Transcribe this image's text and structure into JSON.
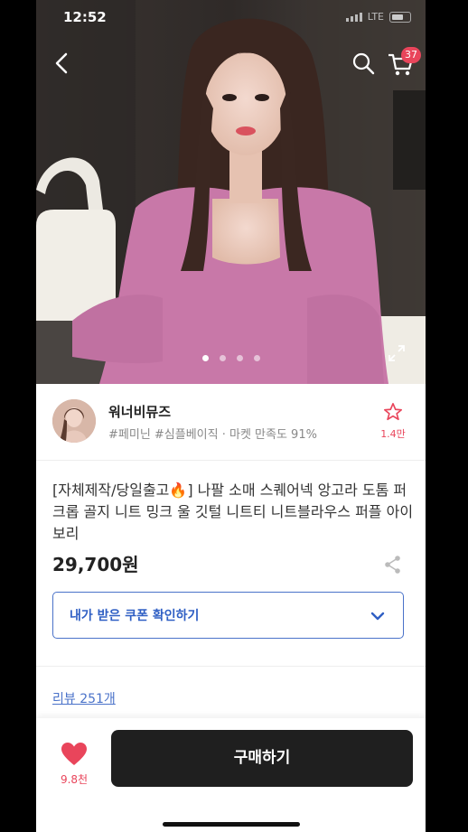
{
  "status_bar": {
    "time": "12:52",
    "network": "LTE"
  },
  "header": {
    "cart_count": "37"
  },
  "gallery": {
    "total_images": 4,
    "current_index": 1
  },
  "seller": {
    "name": "워너비뮤즈",
    "tags": "#페미닌 #심플베이직 · 마켓 만족도 91%",
    "favorites": "1.4만"
  },
  "product": {
    "title": "[자체제작/당일출고🔥] 나팔 소매 스퀘어넥 앙고라 도톰 퍼 크롭 골지 니트 밍크 울 깃털 니트티 니트블라우스 퍼플 아이보리",
    "price": "29,700원"
  },
  "coupon": {
    "label": "내가 받은 쿠폰 확인하기"
  },
  "reviews": {
    "label": "리뷰 251개"
  },
  "bottom_bar": {
    "like_count": "9.8천",
    "buy_label": "구매하기"
  },
  "colors": {
    "accent": "#e9455b",
    "link": "#4a72c9",
    "button": "#1f1f1f"
  },
  "icons": [
    "back-icon",
    "search-icon",
    "cart-icon",
    "expand-icon",
    "star-icon",
    "share-icon",
    "chevron-down-icon",
    "heart-icon"
  ]
}
